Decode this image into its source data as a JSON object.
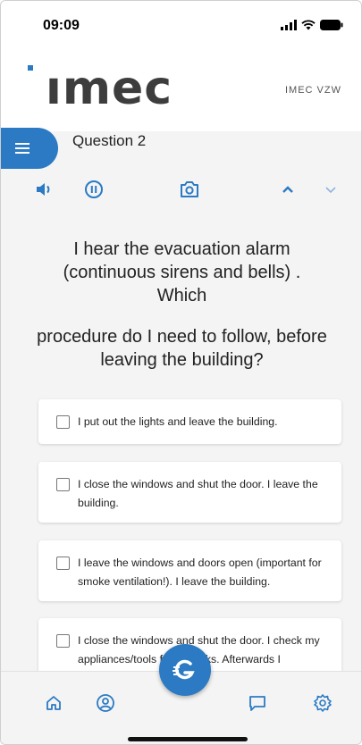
{
  "status_bar": {
    "time": "09:09"
  },
  "header": {
    "logo_text": "ımec",
    "org_name": "IMEC VZW"
  },
  "question": {
    "title": "Question 2",
    "text_line1": "I hear the evacuation alarm (continuous sirens and bells) . Which",
    "text_line2": "procedure do I need to follow, before leaving the building?"
  },
  "toolbar": {
    "icons": [
      "speaker-icon",
      "pause-icon",
      "camera-icon",
      "chevron-up-icon",
      "chevron-down-icon"
    ]
  },
  "answers": [
    {
      "label": "I put out the lights and leave the building."
    },
    {
      "label": "I close the windows and shut the door. I leave the building."
    },
    {
      "label": "I leave the windows and doors open (important for smoke ventilation!). I leave the building."
    },
    {
      "label": "I close the windows and shut the door. I check my appliances/tools for fire risks. Afterwards I"
    }
  ],
  "bottom_nav": {
    "icons": [
      "home-icon",
      "profile-icon",
      "chat-icon",
      "settings-icon"
    ],
    "fab_icon": "g-logo-icon"
  },
  "colors": {
    "accent": "#2b7ac3",
    "background": "#f4f4f4"
  }
}
